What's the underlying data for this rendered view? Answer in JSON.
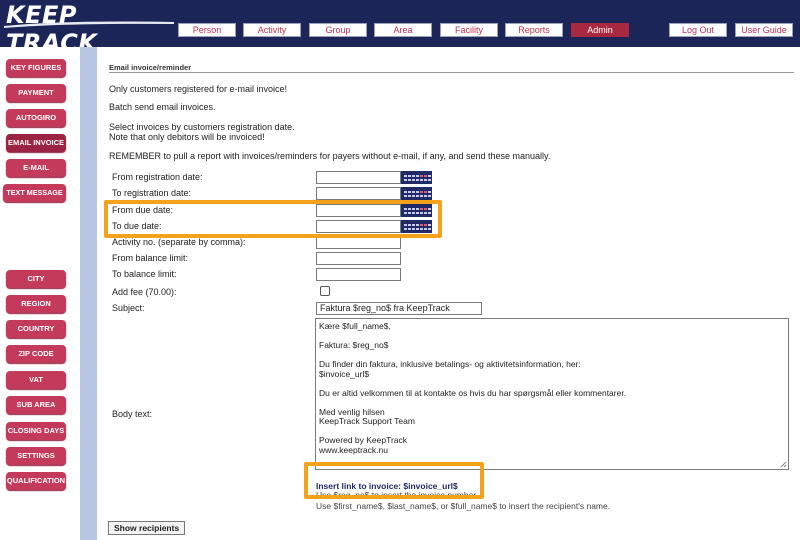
{
  "app": {
    "logo_text": "KEEP TRACK"
  },
  "topnav": {
    "items": [
      "Person",
      "Activity",
      "Group",
      "Area",
      "Facility",
      "Reports",
      "Admin"
    ],
    "active": "Admin",
    "logout": "Log Out",
    "user_guide": "User Guide"
  },
  "sidebar": {
    "items": [
      "KEY FIGURES",
      "PAYMENT",
      "AUTOGIRO",
      "EMAIL INVOICE",
      "E-MAIL",
      "TEXT MESSAGE",
      "CITY",
      "REGION",
      "COUNTRY",
      "ZIP CODE",
      "VAT",
      "SUB AREA",
      "CLOSING DAYS",
      "SETTINGS",
      "QUALIFICATION"
    ],
    "active": "EMAIL INVOICE"
  },
  "main": {
    "section_title": "Email invoice/reminder",
    "info": [
      "Only customers registered for e-mail invoice!",
      "Batch send email invoices.",
      "Select invoices by customers registration date.",
      "Note that only debitors will be invoiced!",
      "REMEMBER to pull a report with invoices/reminders for payers without e-mail, if any, and send these manually."
    ],
    "fields": {
      "from_reg": {
        "label": "From registration date:",
        "value": ""
      },
      "to_reg": {
        "label": "To registration date:",
        "value": ""
      },
      "from_due": {
        "label": "From due date:",
        "value": ""
      },
      "to_due": {
        "label": "To due date:",
        "value": ""
      },
      "activity_no": {
        "label": "Activity no. (separate by comma):",
        "value": ""
      },
      "from_balance": {
        "label": "From balance limit:",
        "value": ""
      },
      "to_balance": {
        "label": "To balance limit:",
        "value": ""
      },
      "add_fee": {
        "label": "Add fee (70.00):",
        "checked": false
      },
      "subject": {
        "label": "Subject:",
        "value": "Faktura $reg_no$ fra KeepTrack"
      },
      "body": {
        "label": "Body text:",
        "lines": [
          "Kære $full_name$,",
          "",
          "Faktura: $reg_no$",
          "",
          "Du finder din faktura, inklusive betalings- og aktivitetsinformation, her:",
          "$invoice_url$",
          "",
          "Du er altid velkommen til at kontakte os hvis du har spørgsmål eller kommentarer.",
          "",
          "Med venlig hilsen",
          "KeepTrack Support Team",
          "",
          "Powered by KeepTrack",
          "www.keeptrack.nu"
        ]
      }
    },
    "insert_link": "Insert link to invoice: $invoice_url$",
    "hint_partial": "Use $reg_no$ to insert the invoice number.",
    "hint_names": "Use $first_name$, $last_name$, or $full_name$ to insert the recipient's name.",
    "show_recipients": "Show recipients"
  },
  "colors": {
    "header_bg": "#1c2558",
    "accent": "#c43a5a",
    "active_nav": "#a8283f",
    "sidebar_edge": "#b8c6e4",
    "highlight": "#f5a21b"
  }
}
